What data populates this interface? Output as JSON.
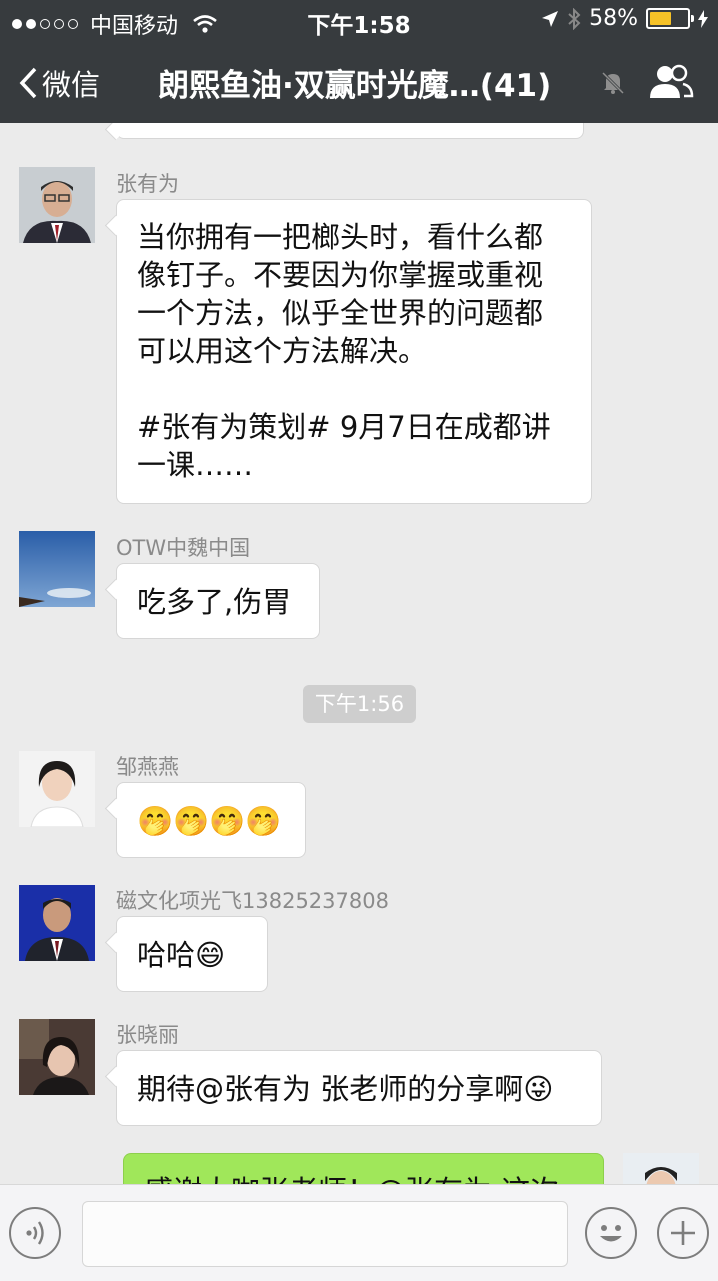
{
  "status_bar": {
    "carrier": "中国移动",
    "time": "下午1:58",
    "battery": "58%",
    "battery_level": 0.58
  },
  "nav": {
    "back_label": "微信",
    "title": "朗熙鱼油·双赢时光魔…(41)"
  },
  "messages": [
    {
      "sender": "张有为",
      "lines": [
        "当你拥有一把榔头时，看什么都",
        "像钉子。不要因为你掌握或重视",
        "一个方法，似乎全世界的问题都",
        "可以用这个方法解决。",
        "",
        "#张有为策划# 9月7日在成都讲",
        "一课……"
      ]
    },
    {
      "sender": "OTW中魏中国",
      "text": "吃多了,伤胃"
    },
    {
      "sender": "邹燕燕",
      "text": "🤭🤭🤭🤭"
    },
    {
      "sender": "磁文化项光飞13825237808",
      "text": "哈哈😄"
    },
    {
      "sender": "张晓丽",
      "text": "期待@张有为 张老师的分享啊😜"
    },
    {
      "sender": "",
      "text": "感谢大咖张老师！@张有为 这次"
    }
  ],
  "timestamp": "下午1:56"
}
